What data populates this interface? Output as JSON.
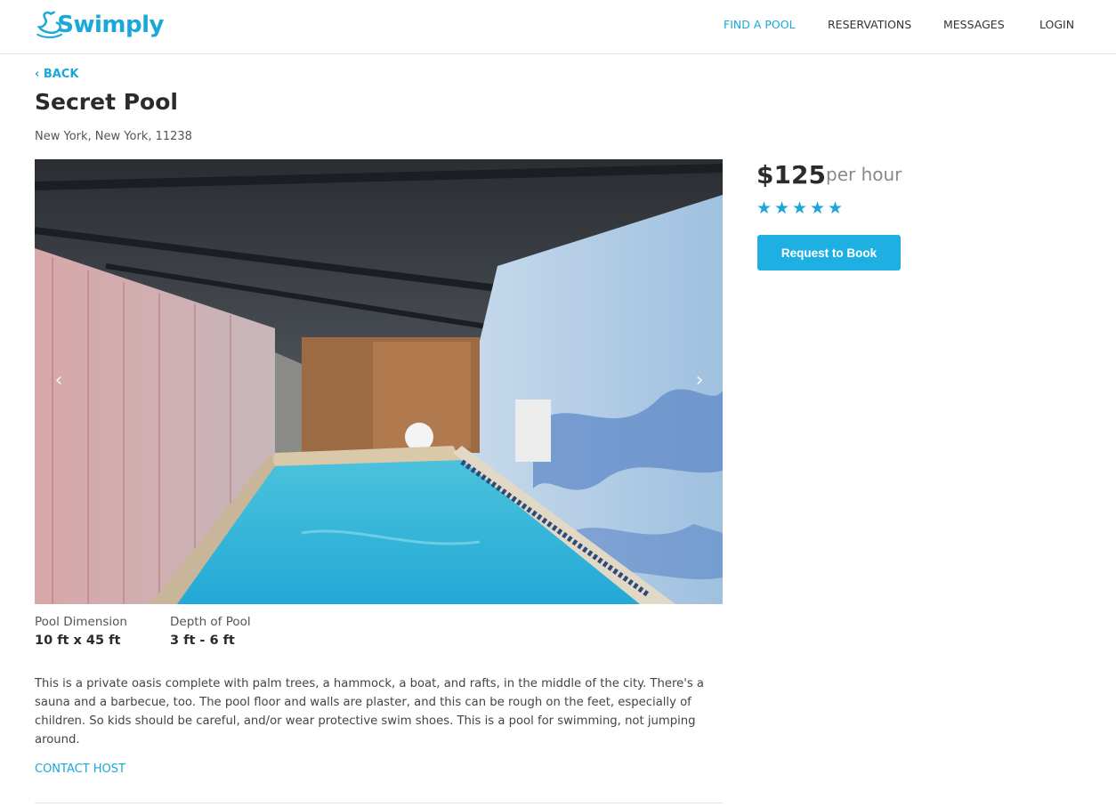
{
  "header": {
    "logo_text": "Swimply",
    "nav": {
      "find": "FIND A POOL",
      "reservations": "RESERVATIONS",
      "messages": "MESSAGES",
      "login": "LOGIN"
    }
  },
  "page": {
    "back": "‹ BACK",
    "title": "Secret Pool",
    "location": "New York, New York, 11238"
  },
  "gallery": {
    "prev_icon": "chevron-left-icon",
    "next_icon": "chevron-right-icon",
    "prev_glyph": "‹",
    "next_glyph": "›"
  },
  "specs": [
    {
      "label": "Pool Dimension",
      "value": "10 ft x 45 ft"
    },
    {
      "label": "Depth of Pool",
      "value": "3 ft - 6 ft"
    }
  ],
  "description": "This is a private oasis complete with palm trees, a hammock, a boat, and rafts, in the middle of the city.  There's a sauna and a barbecue, too. The pool floor and walls are plaster, and this can be rough on the feet, especially of children.  So kids should be careful, and/or wear protective swim shoes. This is a pool for swimming, not jumping around.",
  "contact": "CONTACT HOST",
  "booking": {
    "price": "$125",
    "per": "per hour",
    "rating": 5,
    "star_glyph": "★",
    "button": "Request to Book"
  },
  "colors": {
    "accent": "#19a8d8",
    "button": "#1fb0e3"
  }
}
